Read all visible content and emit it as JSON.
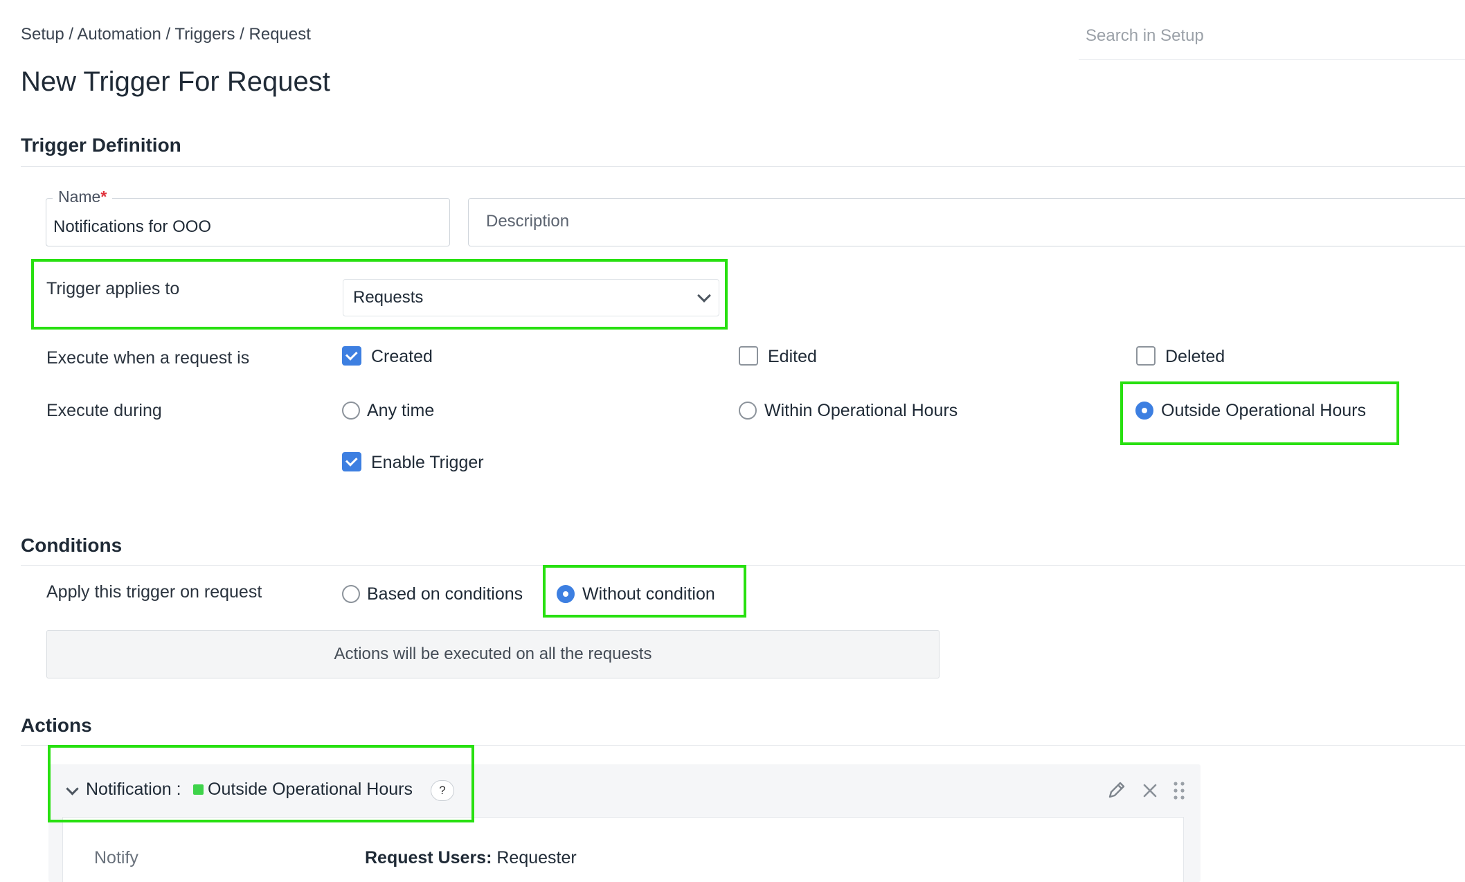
{
  "breadcrumb": "Setup / Automation / Triggers / Request",
  "search": {
    "placeholder": "Search in Setup"
  },
  "page_title": "New Trigger For Request",
  "trigger_definition": {
    "section_title": "Trigger Definition",
    "name_label": "Name",
    "name_required_mark": "*",
    "name_value": "Notifications for OOO",
    "description_placeholder": "Description",
    "applies_to_label": "Trigger applies to",
    "applies_to_value": "Requests",
    "execute_when_label": "Execute when a request is",
    "execute_when_options": [
      {
        "label": "Created",
        "checked": true
      },
      {
        "label": "Edited",
        "checked": false
      },
      {
        "label": "Deleted",
        "checked": false
      }
    ],
    "execute_during_label": "Execute during",
    "execute_during_options": [
      {
        "label": "Any time",
        "selected": false
      },
      {
        "label": "Within Operational Hours",
        "selected": false
      },
      {
        "label": "Outside Operational Hours",
        "selected": true
      }
    ],
    "enable_trigger_label": "Enable Trigger",
    "enable_trigger_checked": true
  },
  "conditions": {
    "section_title": "Conditions",
    "apply_label": "Apply this trigger on request",
    "options": [
      {
        "label": "Based on conditions",
        "selected": false
      },
      {
        "label": "Without condition",
        "selected": true
      }
    ],
    "info_text": "Actions will be executed on all the requests"
  },
  "actions": {
    "section_title": "Actions",
    "notification_prefix": "Notification :",
    "notification_name": "Outside Operational Hours",
    "help_symbol": "?",
    "notify_label": "Notify",
    "notify_key": "Request Users:",
    "notify_value": "Requester"
  },
  "colors": {
    "highlight": "#28e010",
    "accent": "#3d7fe1",
    "required": "#e0323c",
    "status_dot": "#3ed34a"
  }
}
